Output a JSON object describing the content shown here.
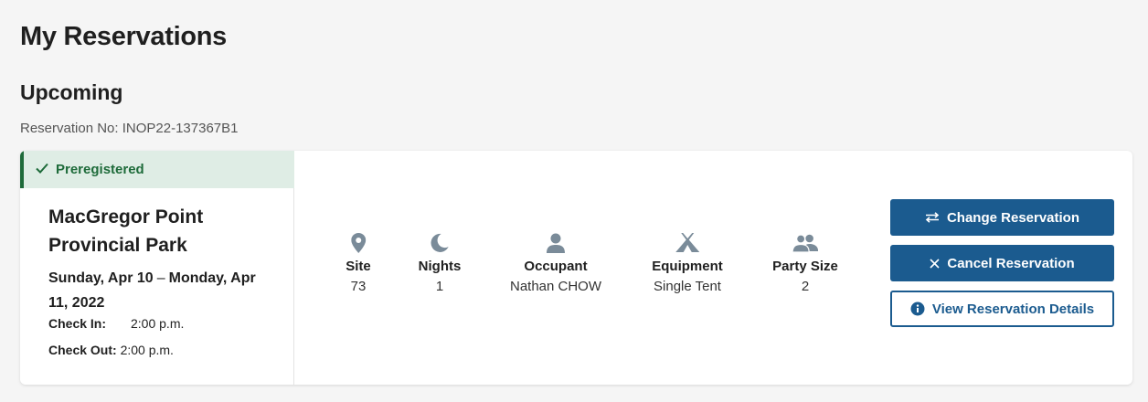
{
  "page": {
    "title": "My Reservations",
    "section": "Upcoming",
    "reservation_no": "Reservation No: INOP22-137367B1"
  },
  "reservation": {
    "status": "Preregistered",
    "park_name": "MacGregor Point Provincial Park",
    "start_date": "Sunday, Apr 10",
    "date_separator": "–",
    "end_date": "Monday, Apr 11, 2022",
    "check_in_label": "Check In:",
    "check_in_time": "2:00 p.m.",
    "check_out_label": "Check Out:",
    "check_out_time": "2:00 p.m."
  },
  "stats": {
    "site": {
      "label": "Site",
      "value": "73",
      "icon": "map-pin-icon"
    },
    "nights": {
      "label": "Nights",
      "value": "1",
      "icon": "moon-icon"
    },
    "occupant": {
      "label": "Occupant",
      "value": "Nathan CHOW",
      "icon": "person-icon"
    },
    "equipment": {
      "label": "Equipment",
      "value": "Single Tent",
      "icon": "tent-icon"
    },
    "party_size": {
      "label": "Party Size",
      "value": "2",
      "icon": "group-icon"
    }
  },
  "actions": {
    "change": "Change Reservation",
    "cancel": "Cancel Reservation",
    "details": "View Reservation Details"
  },
  "colors": {
    "primary": "#1b5b8f",
    "status_green": "#1e6b3a",
    "status_bg": "#dfede5",
    "icon_gray": "#7a8b99"
  }
}
